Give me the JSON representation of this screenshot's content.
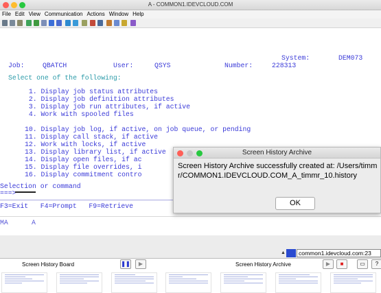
{
  "window": {
    "title": "A - COMMON1.IDEVCLOUD.COM"
  },
  "menu": [
    "File",
    "Edit",
    "View",
    "Communication",
    "Actions",
    "Window",
    "Help"
  ],
  "terminal": {
    "system_label": "System:",
    "system_value": "DEM073",
    "job_label": "Job:",
    "job_value": "QBATCH",
    "user_label": "User:",
    "user_value": "QSYS",
    "number_label": "Number:",
    "number_value": "228313",
    "prompt": "Select one of the following:",
    "options": [
      " 1. Display job status attributes",
      " 2. Display job definition attributes",
      " 3. Display job run attributes, if active",
      " 4. Work with spooled files",
      "10. Display job log, if active, on job queue, or pending",
      "11. Display call stack, if active",
      "12. Work with locks, if active",
      "13. Display library list, if active",
      "14. Display open files, if ac",
      "15. Display file overrides, i",
      "16. Display commitment contro"
    ],
    "selection_label": "Selection or command",
    "arrow": "===>",
    "fkeys": "F3=Exit   F4=Prompt   F9=Retrieve",
    "status_left": "MA",
    "status_right": "A"
  },
  "dialog": {
    "title": "Screen History Archive",
    "message": "Screen History Archive successfully created at: /Users/timmr/COMMON1.IDEVCLOUD.COM_A_timmr_10.history",
    "ok_label": "OK"
  },
  "history_bar": {
    "url": "common1.idevcloud.com:23",
    "board_label": "Screen History Board",
    "archive_label": "Screen History Archive",
    "help_label": "?"
  },
  "colors": {
    "term_blue": "#3434c8",
    "term_teal": "#2a9aa8",
    "record_red": "#e02020",
    "pause_blue": "#2c3ad0"
  }
}
